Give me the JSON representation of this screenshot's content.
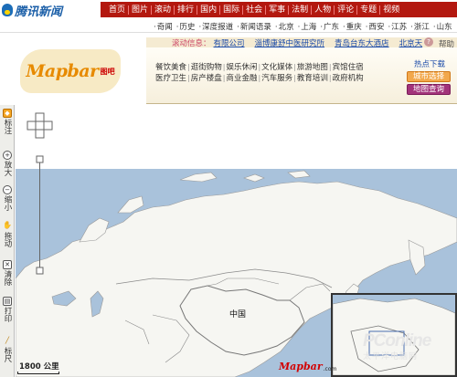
{
  "top": {
    "logo_text": "腾讯新闻",
    "nav": [
      "首页",
      "图片",
      "滚动",
      "排行",
      "国内",
      "国际",
      "社会",
      "军事",
      "法制",
      "人物",
      "评论",
      "专题",
      "视频"
    ],
    "subnav": [
      "奇闻",
      "历史",
      "深度报道",
      "新闻语录",
      "北京",
      "上海",
      "广东",
      "重庆",
      "西安",
      "江苏",
      "浙江",
      "山东"
    ]
  },
  "mapbar": {
    "logo_text": "Mapbar",
    "logo_sub": "图吧",
    "scroll_label": "滚动信息：",
    "scroll_items": [
      "有限公司",
      "淄博康舒中医研究所",
      "青岛台东大酒店",
      "北京天"
    ],
    "help_label": "帮助",
    "help_icon": "?",
    "categories_line1": [
      "餐饮美食",
      "逛街购物",
      "娱乐休闲",
      "文化媒体",
      "旅游地图",
      "宾馆住宿"
    ],
    "categories_line2": [
      "医疗卫生",
      "房产楼盘",
      "商业金融",
      "汽车服务",
      "教育培训",
      "政府机构"
    ],
    "hot_download": "热点下载",
    "city_select": "城市选择",
    "map_query": "地图查询"
  },
  "tools": [
    {
      "icon": "tag-icon",
      "glyph": "◆",
      "label": "标注"
    },
    {
      "icon": "zoom-in-icon",
      "glyph": "+",
      "label": "放大"
    },
    {
      "icon": "zoom-out-icon",
      "glyph": "−",
      "label": "缩小"
    },
    {
      "icon": "hand-icon",
      "glyph": "✋",
      "label": "拖动"
    },
    {
      "icon": "clear-icon",
      "glyph": "✕",
      "label": "清除"
    },
    {
      "icon": "print-icon",
      "glyph": "▤",
      "label": "打印"
    },
    {
      "icon": "ruler-icon",
      "glyph": "╱",
      "label": "标尺"
    }
  ],
  "map": {
    "country_label": "中国",
    "scale_text": "1800 公里",
    "brand": "Mapbar",
    "brand_sub": ".com",
    "zoom_level_fraction": 0.25,
    "colors": {
      "sea": "#a9c2db",
      "land": "#f6f6f2",
      "border": "#888888"
    }
  },
  "watermark": {
    "line1": "PConline",
    "line2": "太平洋电脑网"
  }
}
